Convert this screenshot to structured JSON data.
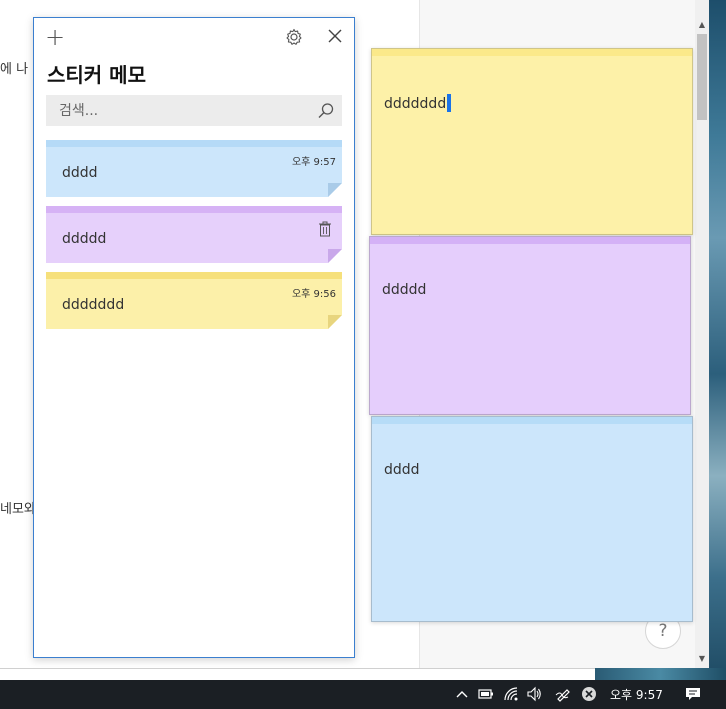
{
  "background_doc": {
    "text_1": "에 나",
    "text_2": "네모와"
  },
  "list_window": {
    "title": "스티커 메모",
    "search_placeholder": "검색...",
    "notes": [
      {
        "text": "dddd",
        "time": "오후 9:57",
        "color": "#cce6fb"
      },
      {
        "text": "ddddd",
        "time": "",
        "color": "#e6d0fb"
      },
      {
        "text": "ddddddd",
        "time": "오후 9:56",
        "color": "#fcf0a9"
      }
    ]
  },
  "open_notes": {
    "yellow": {
      "text": "ddddddd",
      "color": "#fdf1a8"
    },
    "purple": {
      "text": "ddddd",
      "color": "#e5cefc"
    },
    "blue": {
      "text": "dddd",
      "color": "#cce6fb"
    }
  },
  "help_button": {
    "label": "?"
  },
  "taskbar": {
    "clock": "오후 9:57",
    "icons": [
      "chevron-up-icon",
      "battery-icon",
      "wifi-icon",
      "volume-icon",
      "pen-icon",
      "close-circle-icon",
      "notification-icon"
    ]
  }
}
